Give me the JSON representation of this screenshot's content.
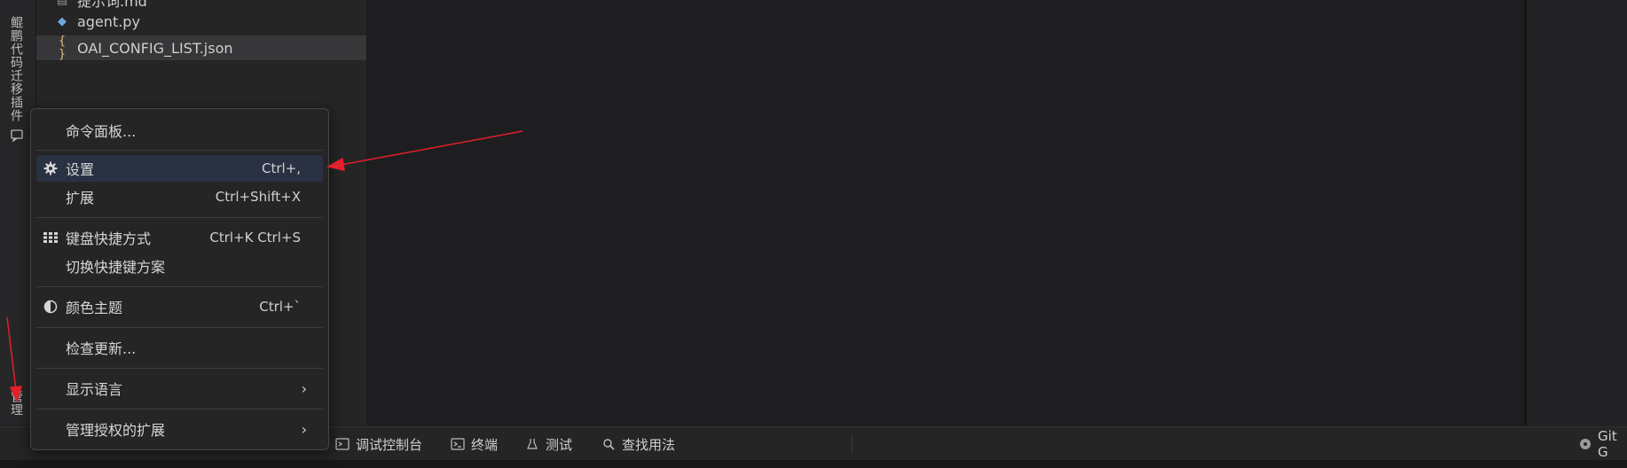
{
  "activity": {
    "plugin_tab": "鲲鹏代码迁移插件",
    "manage_tab": "管理"
  },
  "explorer": {
    "files": [
      {
        "name": "提示词.md",
        "icon": "markdown-icon"
      },
      {
        "name": "agent.py",
        "icon": "python-file-icon"
      },
      {
        "name": "OAI_CONFIG_LIST.json",
        "icon": "json-file-icon"
      }
    ]
  },
  "menu": {
    "command_palette": {
      "label": "命令面板..."
    },
    "settings": {
      "label": "设置",
      "shortcut": "Ctrl+,"
    },
    "extensions": {
      "label": "扩展",
      "shortcut": "Ctrl+Shift+X"
    },
    "keyboard_shortcuts": {
      "label": "键盘快捷方式",
      "shortcut": "Ctrl+K Ctrl+S"
    },
    "keymaps": {
      "label": "切换快捷键方案"
    },
    "color_theme": {
      "label": "颜色主题",
      "shortcut": "Ctrl+`"
    },
    "check_updates": {
      "label": "检查更新..."
    },
    "display_language": {
      "label": "显示语言",
      "arrow": "›"
    },
    "manage_trusted_extensions": {
      "label": "管理授权的扩展",
      "arrow": "›"
    }
  },
  "panel": {
    "tabs": [
      {
        "label": "调试控制台",
        "icon": "debug-console-icon"
      },
      {
        "label": "终端",
        "icon": "terminal-icon"
      },
      {
        "label": "测试",
        "icon": "beaker-icon"
      },
      {
        "label": "查找用法",
        "icon": "search-icon"
      }
    ],
    "git_label": "Git G"
  },
  "colors": {
    "annotation": "#e0202a",
    "menu_selected": "#2a3142",
    "editor_bg": "#1e1e20"
  }
}
